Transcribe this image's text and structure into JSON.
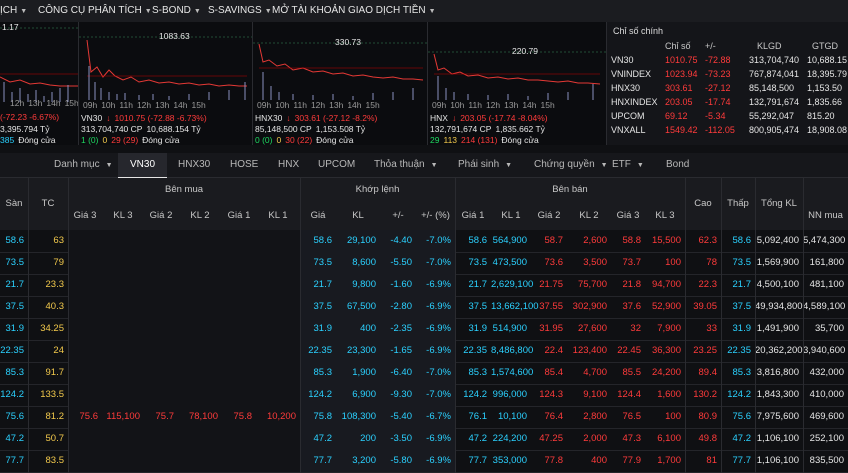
{
  "nav": {
    "items": [
      "ỊCH",
      "CÔNG CỤ PHÂN TÍCH",
      "S-BOND",
      "S-SAVINGS",
      "MỞ TÀI KHOẢN",
      "GIAO DỊCH TIỀN"
    ]
  },
  "charts": [
    {
      "name": "",
      "peak": "",
      "top": "1.17",
      "change": "(-72.23 -6.67%)",
      "vol": "3,395.794 Tỷ",
      "counts": [
        "385",
        "",
        "Đóng cửa"
      ],
      "times": [
        "12h",
        "13h",
        "14h",
        "15h"
      ]
    },
    {
      "name": "VN30",
      "peak": "1083.63",
      "change": "1010.75 (-72.88 -6.73%)",
      "vol1": "313,704,740 CP",
      "vol2": "10,688.154 Tỷ",
      "counts": [
        "1 (0)",
        "0",
        "29 (29)",
        "Đóng cửa"
      ],
      "times": [
        "09h",
        "10h",
        "11h",
        "12h",
        "13h",
        "14h",
        "15h"
      ]
    },
    {
      "name": "HNX30",
      "peak": "330.73",
      "change": "303.61 (-27.12 -8.2%)",
      "vol1": "85,148,500 CP",
      "vol2": "1,153.508 Tỷ",
      "counts": [
        "0 (0)",
        "0",
        "30 (22)",
        "Đóng cửa"
      ],
      "times": [
        "09h",
        "10h",
        "11h",
        "12h",
        "13h",
        "14h",
        "15h"
      ]
    },
    {
      "name": "HNX",
      "peak": "220.79",
      "change": "203.05 (-17.74 -8.04%)",
      "vol1": "132,791,674 CP",
      "vol2": "1,835.662 Tỷ",
      "counts": [
        "29",
        "113",
        "214 (131)",
        "Đóng cửa"
      ],
      "times": [
        "09h",
        "10h",
        "11h",
        "12h",
        "13h",
        "14h",
        "15h"
      ]
    }
  ],
  "index_panel": {
    "title": "Chỉ số chính",
    "headers": [
      "Chỉ số",
      "+/-",
      "KLGD",
      "GTGD"
    ],
    "rows": [
      {
        "name": "VN30",
        "value": "1010.75",
        "change": "-72.88",
        "vol": "313,704,740",
        "val": "10,688.15"
      },
      {
        "name": "VNINDEX",
        "value": "1023.94",
        "change": "-73.23",
        "vol": "767,874,041",
        "val": "18,395.79"
      },
      {
        "name": "HNX30",
        "value": "303.61",
        "change": "-27.12",
        "vol": "85,148,500",
        "val": "1,153.50"
      },
      {
        "name": "HNXINDEX",
        "value": "203.05",
        "change": "-17.74",
        "vol": "132,791,674",
        "val": "1,835.66"
      },
      {
        "name": "UPCOM",
        "value": "69.12",
        "change": "-5.34",
        "vol": "55,292,047",
        "val": "815.20"
      },
      {
        "name": "VNXALL",
        "value": "1549.42",
        "change": "-112.05",
        "vol": "800,905,474",
        "val": "18,908.08"
      }
    ]
  },
  "tabs": [
    "Danh mục",
    "VN30",
    "HNX30",
    "HOSE",
    "HNX",
    "UPCOM",
    "Thỏa thuận",
    "Phái sinh",
    "Chứng quyền",
    "ETF",
    "Bond"
  ],
  "table_headers": {
    "san": "Sàn",
    "tc": "TC",
    "ben_mua": "Bên mua",
    "khop_lenh": "Khớp lệnh",
    "ben_ban": "Bên bán",
    "cao": "Cao",
    "thap": "Thấp",
    "tong_kl": "Tổng KL",
    "nn_mua": "NN mua",
    "mua": [
      "Giá 3",
      "KL 3",
      "Giá 2",
      "KL 2",
      "Giá 1",
      "KL 1"
    ],
    "khop": [
      "Giá",
      "KL",
      "+/-",
      "+/- (%)"
    ],
    "ban": [
      "Giá 1",
      "KL 1",
      "Giá 2",
      "KL 2",
      "Giá 3",
      "KL 3"
    ]
  },
  "rows": [
    {
      "san": "58.6",
      "tc": "63",
      "b3": "",
      "bk3": "",
      "b2": "",
      "bk2": "",
      "b1": "",
      "bk1": "",
      "p": "58.6",
      "kl": "29,100",
      "ch": "-4.40",
      "pct": "-7.0%",
      "s1": "58.6",
      "sk1": "564,900",
      "s2": "58.7",
      "sk2": "2,600",
      "s3": "58.8",
      "sk3": "15,500",
      "cao": "62.3",
      "thap": "58.6",
      "tkl": "5,092,400",
      "nn": "5,474,300"
    },
    {
      "san": "73.5",
      "tc": "79",
      "b3": "",
      "bk3": "",
      "b2": "",
      "bk2": "",
      "b1": "",
      "bk1": "",
      "p": "73.5",
      "kl": "8,600",
      "ch": "-5.50",
      "pct": "-7.0%",
      "s1": "73.5",
      "sk1": "473,500",
      "s2": "73.6",
      "sk2": "3,500",
      "s3": "73.7",
      "sk3": "100",
      "cao": "78",
      "thap": "73.5",
      "tkl": "1,569,900",
      "nn": "161,800"
    },
    {
      "san": "21.7",
      "tc": "23.3",
      "b3": "",
      "bk3": "",
      "b2": "",
      "bk2": "",
      "b1": "",
      "bk1": "",
      "p": "21.7",
      "kl": "9,800",
      "ch": "-1.60",
      "pct": "-6.9%",
      "s1": "21.7",
      "sk1": "2,629,100",
      "s2": "21.75",
      "sk2": "75,700",
      "s3": "21.8",
      "sk3": "94,700",
      "cao": "22.3",
      "thap": "21.7",
      "tkl": "4,500,100",
      "nn": "481,100"
    },
    {
      "san": "37.5",
      "tc": "40.3",
      "b3": "",
      "bk3": "",
      "b2": "",
      "bk2": "",
      "b1": "",
      "bk1": "",
      "p": "37.5",
      "kl": "67,500",
      "ch": "-2.80",
      "pct": "-6.9%",
      "s1": "37.5",
      "sk1": "13,662,100",
      "s2": "37.55",
      "sk2": "302,900",
      "s3": "37.6",
      "sk3": "52,900",
      "cao": "39.05",
      "thap": "37.5",
      "tkl": "49,934,800",
      "nn": "4,589,100"
    },
    {
      "san": "31.9",
      "tc": "34.25",
      "b3": "",
      "bk3": "",
      "b2": "",
      "bk2": "",
      "b1": "",
      "bk1": "",
      "p": "31.9",
      "kl": "400",
      "ch": "-2.35",
      "pct": "-6.9%",
      "s1": "31.9",
      "sk1": "514,900",
      "s2": "31.95",
      "sk2": "27,600",
      "s3": "32",
      "sk3": "7,900",
      "cao": "33",
      "thap": "31.9",
      "tkl": "1,491,900",
      "nn": "35,700"
    },
    {
      "san": "22.35",
      "tc": "24",
      "b3": "",
      "bk3": "",
      "b2": "",
      "bk2": "",
      "b1": "",
      "bk1": "",
      "p": "22.35",
      "kl": "23,300",
      "ch": "-1.65",
      "pct": "-6.9%",
      "s1": "22.35",
      "sk1": "8,486,800",
      "s2": "22.4",
      "sk2": "123,400",
      "s3": "22.45",
      "sk3": "36,300",
      "cao": "23.25",
      "thap": "22.35",
      "tkl": "20,362,200",
      "nn": "3,940,600"
    },
    {
      "san": "85.3",
      "tc": "91.7",
      "b3": "",
      "bk3": "",
      "b2": "",
      "bk2": "",
      "b1": "",
      "bk1": "",
      "p": "85.3",
      "kl": "1,900",
      "ch": "-6.40",
      "pct": "-7.0%",
      "s1": "85.3",
      "sk1": "1,574,600",
      "s2": "85.4",
      "sk2": "4,700",
      "s3": "85.5",
      "sk3": "24,200",
      "cao": "89.4",
      "thap": "85.3",
      "tkl": "3,816,800",
      "nn": "432,000"
    },
    {
      "san": "124.2",
      "tc": "133.5",
      "b3": "",
      "bk3": "",
      "b2": "",
      "bk2": "",
      "b1": "",
      "bk1": "",
      "p": "124.2",
      "kl": "6,900",
      "ch": "-9.30",
      "pct": "-7.0%",
      "s1": "124.2",
      "sk1": "996,000",
      "s2": "124.3",
      "sk2": "9,100",
      "s3": "124.4",
      "sk3": "1,600",
      "cao": "130.2",
      "thap": "124.2",
      "tkl": "1,843,300",
      "nn": "410,000"
    },
    {
      "san": "75.6",
      "tc": "81.2",
      "b3": "75.6",
      "bk3": "115,100",
      "b2": "75.7",
      "bk2": "78,100",
      "b1": "75.8",
      "bk1": "10,200",
      "p": "75.8",
      "kl": "108,300",
      "ch": "-5.40",
      "pct": "-6.7%",
      "s1": "76.1",
      "sk1": "10,100",
      "s2": "76.4",
      "sk2": "2,800",
      "s3": "76.5",
      "sk3": "100",
      "cao": "80.9",
      "thap": "75.6",
      "tkl": "7,975,600",
      "nn": "469,600"
    },
    {
      "san": "47.2",
      "tc": "50.7",
      "b3": "",
      "bk3": "",
      "b2": "",
      "bk2": "",
      "b1": "",
      "bk1": "",
      "p": "47.2",
      "kl": "200",
      "ch": "-3.50",
      "pct": "-6.9%",
      "s1": "47.2",
      "sk1": "224,200",
      "s2": "47.25",
      "sk2": "2,000",
      "s3": "47.3",
      "sk3": "6,100",
      "cao": "49.8",
      "thap": "47.2",
      "tkl": "1,106,100",
      "nn": "252,100"
    },
    {
      "san": "77.7",
      "tc": "83.5",
      "b3": "",
      "bk3": "",
      "b2": "",
      "bk2": "",
      "b1": "",
      "bk1": "",
      "p": "77.7",
      "kl": "3,200",
      "ch": "-5.80",
      "pct": "-6.9%",
      "s1": "77.7",
      "sk1": "353,000",
      "s2": "77.8",
      "sk2": "400",
      "s3": "77.9",
      "sk3": "1,700",
      "cao": "81",
      "thap": "77.7",
      "tkl": "1,106,100",
      "nn": "835,500"
    }
  ]
}
